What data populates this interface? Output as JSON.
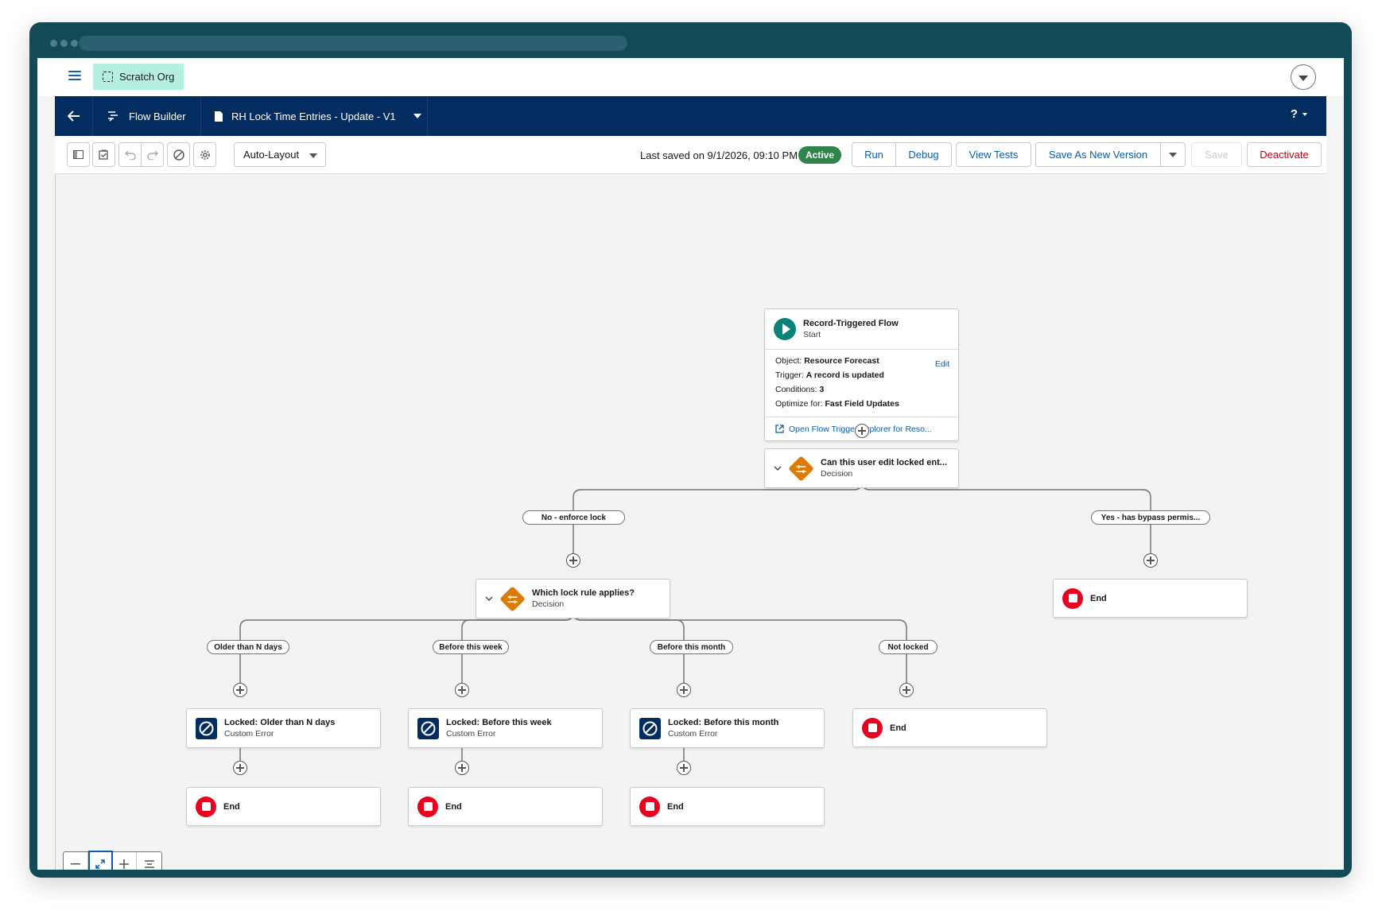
{
  "app": {
    "org_badge": "Scratch Org",
    "nav_app": "Flow Builder",
    "flow_name": "RH Lock Time Entries - Update - V1",
    "help": "?"
  },
  "toolbar": {
    "layout_select": "Auto-Layout",
    "last_saved": "Last saved on 9/1/2026, 09:10 PM",
    "status": "Active",
    "run": "Run",
    "debug": "Debug",
    "view_tests": "View Tests",
    "save_as_new": "Save As New Version",
    "save": "Save",
    "deactivate": "Deactivate"
  },
  "start": {
    "title": "Record-Triggered Flow",
    "subtitle": "Start",
    "object_label": "Object:",
    "object_value": "Resource Forecast",
    "edit": "Edit",
    "trigger_label": "Trigger:",
    "trigger_value": "A record is updated",
    "conditions_label": "Conditions:",
    "conditions_value": "3",
    "optimize_label": "Optimize for:",
    "optimize_value": "Fast Field Updates",
    "explorer_link": "Open Flow Trigger Explorer for Reso..."
  },
  "decision1": {
    "title": "Can this user edit locked ent...",
    "subtitle": "Decision",
    "outcomes": [
      "No - enforce lock",
      "Yes - has bypass permis..."
    ]
  },
  "decision2": {
    "title": "Which lock rule applies?",
    "subtitle": "Decision",
    "outcomes": [
      "Older than N days",
      "Before this week",
      "Before this month",
      "Not locked"
    ]
  },
  "errors": [
    {
      "title": "Locked: Older than N days",
      "subtitle": "Custom Error"
    },
    {
      "title": "Locked: Before this week",
      "subtitle": "Custom Error"
    },
    {
      "title": "Locked: Before this month",
      "subtitle": "Custom Error"
    }
  ],
  "end_label": "End",
  "colors": {
    "nav": "#032d60",
    "frame": "#134a57",
    "active": "#2e844a",
    "start": "#0b827c",
    "decision": "#dd7a01",
    "end": "#ea001e",
    "link": "#0b5cab"
  }
}
